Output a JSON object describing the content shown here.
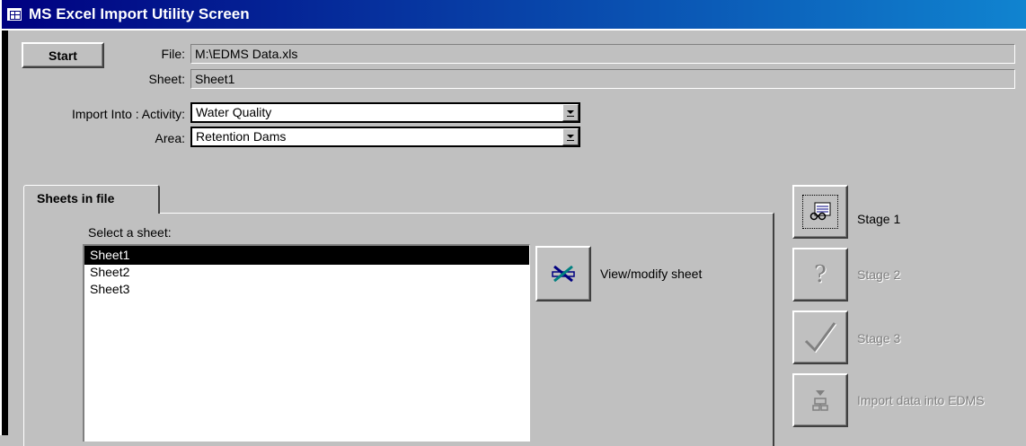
{
  "window": {
    "title": "MS Excel Import Utility Screen",
    "icon": "form-icon"
  },
  "start_button": {
    "label": "Start"
  },
  "file": {
    "label": "File:",
    "value": "M:\\EDMS Data.xls"
  },
  "sheet": {
    "label": "Sheet:",
    "value": "Sheet1"
  },
  "import_into": {
    "activity_label": "Import Into : Activity:",
    "activity_value": "Water Quality",
    "area_label": "Area:",
    "area_value": "Retention Dams"
  },
  "tabs": [
    {
      "label": "Sheets in file",
      "active": true
    }
  ],
  "sheets_panel": {
    "select_label": "Select a sheet:",
    "items": [
      "Sheet1",
      "Sheet2",
      "Sheet3"
    ],
    "selected": "Sheet1",
    "view_modify_label": "View/modify sheet"
  },
  "stages": [
    {
      "label": "Stage 1",
      "enabled": true,
      "icon": "stage1-icon"
    },
    {
      "label": "Stage 2",
      "enabled": false,
      "icon": "question-icon"
    },
    {
      "label": "Stage 3",
      "enabled": false,
      "icon": "checkmark-icon"
    },
    {
      "label": "Import data into EDMS",
      "enabled": false,
      "icon": "import-icon"
    }
  ],
  "colors": {
    "titlebar_start": "#000080",
    "titlebar_end": "#1084d0",
    "face": "#c0c0c0"
  }
}
